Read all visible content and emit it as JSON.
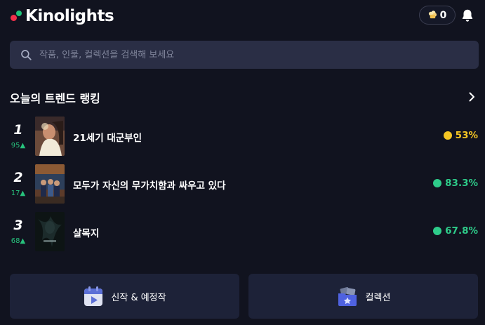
{
  "header": {
    "brand": "Kinolights",
    "coin_count": "0",
    "coin_icon": "popcorn-icon",
    "notification_icon": "bell-icon"
  },
  "search": {
    "placeholder": "작품, 인물, 컬렉션을 검색해 보세요"
  },
  "trend": {
    "title": "오늘의 트렌드 랭킹",
    "items": [
      {
        "rank": "1",
        "change": "95▲",
        "title": "21세기 대군부인",
        "score": "53%",
        "score_color": "#f5c623",
        "dot_color": "#f5c623"
      },
      {
        "rank": "2",
        "change": "17▲",
        "title": "모두가 자신의 무가치함과 싸우고 있다",
        "score": "83.3%",
        "score_color": "#2ecc8a",
        "dot_color": "#2ecc8a"
      },
      {
        "rank": "3",
        "change": "68▲",
        "title": "살목지",
        "score": "67.8%",
        "score_color": "#2ecc8a",
        "dot_color": "#2ecc8a"
      }
    ]
  },
  "bottom_buttons": {
    "new_releases_label": "신작 & 예정작",
    "collections_label": "컬렉션"
  },
  "colors": {
    "background": "#11131f",
    "surface": "#1d2238",
    "search_bg": "#2a2e45",
    "rank_up": "#27c17c",
    "brand_red": "#f0304a",
    "brand_green": "#1fc37a"
  }
}
